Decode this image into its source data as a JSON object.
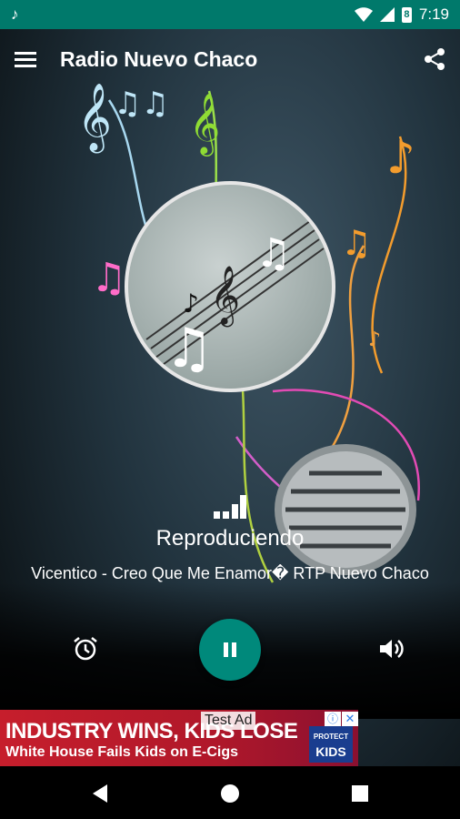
{
  "status_bar": {
    "time": "7:19",
    "notification_icon": "music-note-icon",
    "battery_level": "8"
  },
  "toolbar": {
    "title": "Radio Nuevo Chaco",
    "menu_icon": "hamburger-menu-icon",
    "share_icon": "share-icon"
  },
  "player": {
    "state": "Reproduciendo",
    "track": "Vicentico - Creo Que Me Enamor� RTP Nuevo Chaco",
    "alarm_icon": "alarm-icon",
    "pause_icon": "pause-icon",
    "volume_icon": "volume-icon"
  },
  "ad": {
    "label": "Test Ad",
    "headline": "INDUSTRY WINS, KIDS LOSE",
    "subline": "White House Fails Kids on E-Cigs",
    "logo_top": "PROTECT",
    "logo_bottom": "KIDS"
  },
  "colors": {
    "status_bar": "#00796b",
    "accent": "#00897b",
    "ad_bg": "#c61e2c"
  }
}
